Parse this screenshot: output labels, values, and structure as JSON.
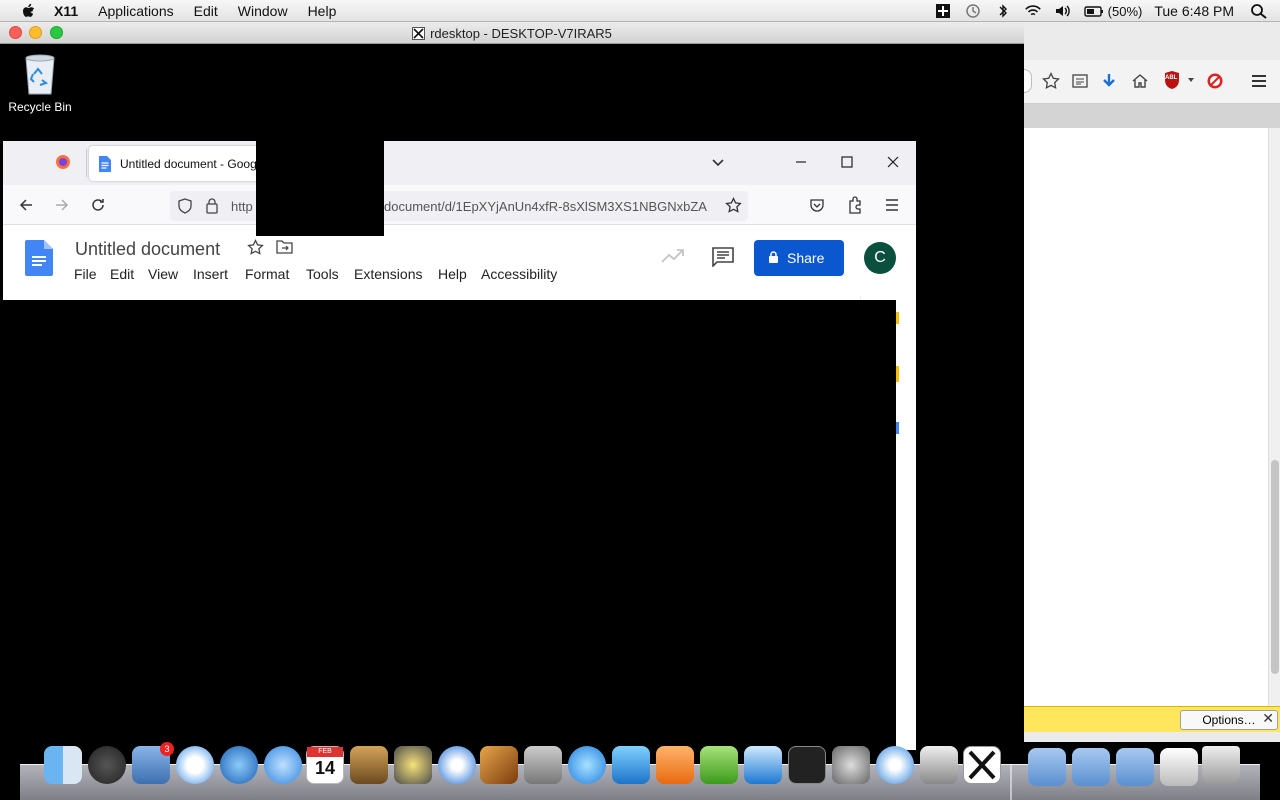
{
  "menubar": {
    "app": "X11",
    "items": [
      "Applications",
      "Edit",
      "Window",
      "Help"
    ],
    "battery": "(50%)",
    "clock": "Tue 6:48 PM"
  },
  "rdesktop": {
    "title": "rdesktop - DESKTOP-V7IRAR5"
  },
  "desktop": {
    "recycle_bin_label": "Recycle Bin"
  },
  "browser": {
    "tab_title": "Untitled document - Goog",
    "url_prefix": "http",
    "url_rest": "document/d/1EpXYjAnUn4xfR-8sXlSM3XS1NBGNxbZA"
  },
  "doc": {
    "title": "Untitled document",
    "menu": [
      "File",
      "Edit",
      "View",
      "Insert",
      "Format",
      "Tools",
      "Extensions",
      "Help",
      "Accessibility"
    ],
    "share_label": "Share",
    "avatar_letter": "C"
  },
  "firefox_bg": {
    "options_label": "Options…",
    "close_label": "✕",
    "addon_badge": "ABL"
  },
  "dock": {
    "mail_badge": "3",
    "calendar_month": "FEB",
    "calendar_day": "14"
  },
  "colors": {
    "share_blue": "#0b57d0",
    "docs_blue": "#4285f4",
    "avatar_green": "#0b4f3f",
    "notif_yellow": "#ffe65c"
  }
}
